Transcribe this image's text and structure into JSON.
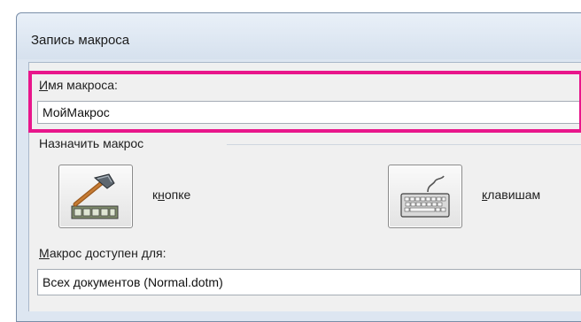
{
  "dialog": {
    "title": "Запись макроса"
  },
  "macro_name": {
    "label_u": "И",
    "label_rest": "мя макроса:",
    "value": "МойМакрос"
  },
  "assign": {
    "label": "Назначить макрос",
    "button_label_pre": "к",
    "button_label_u": "н",
    "button_label_rest": "опке",
    "keyboard_label_u": "к",
    "keyboard_label_rest": "лавишам"
  },
  "store": {
    "label_u": "М",
    "label_rest": "акрос доступен для:",
    "value": "Всех документов (Normal.dotm)"
  },
  "colors": {
    "highlight": "#e8168b",
    "dialog_bg": "#f0f0f0",
    "frame": "#dde6f1"
  },
  "icons": {
    "button_icon": "hammer-toolbar-icon",
    "keyboard_icon": "keyboard-icon"
  }
}
